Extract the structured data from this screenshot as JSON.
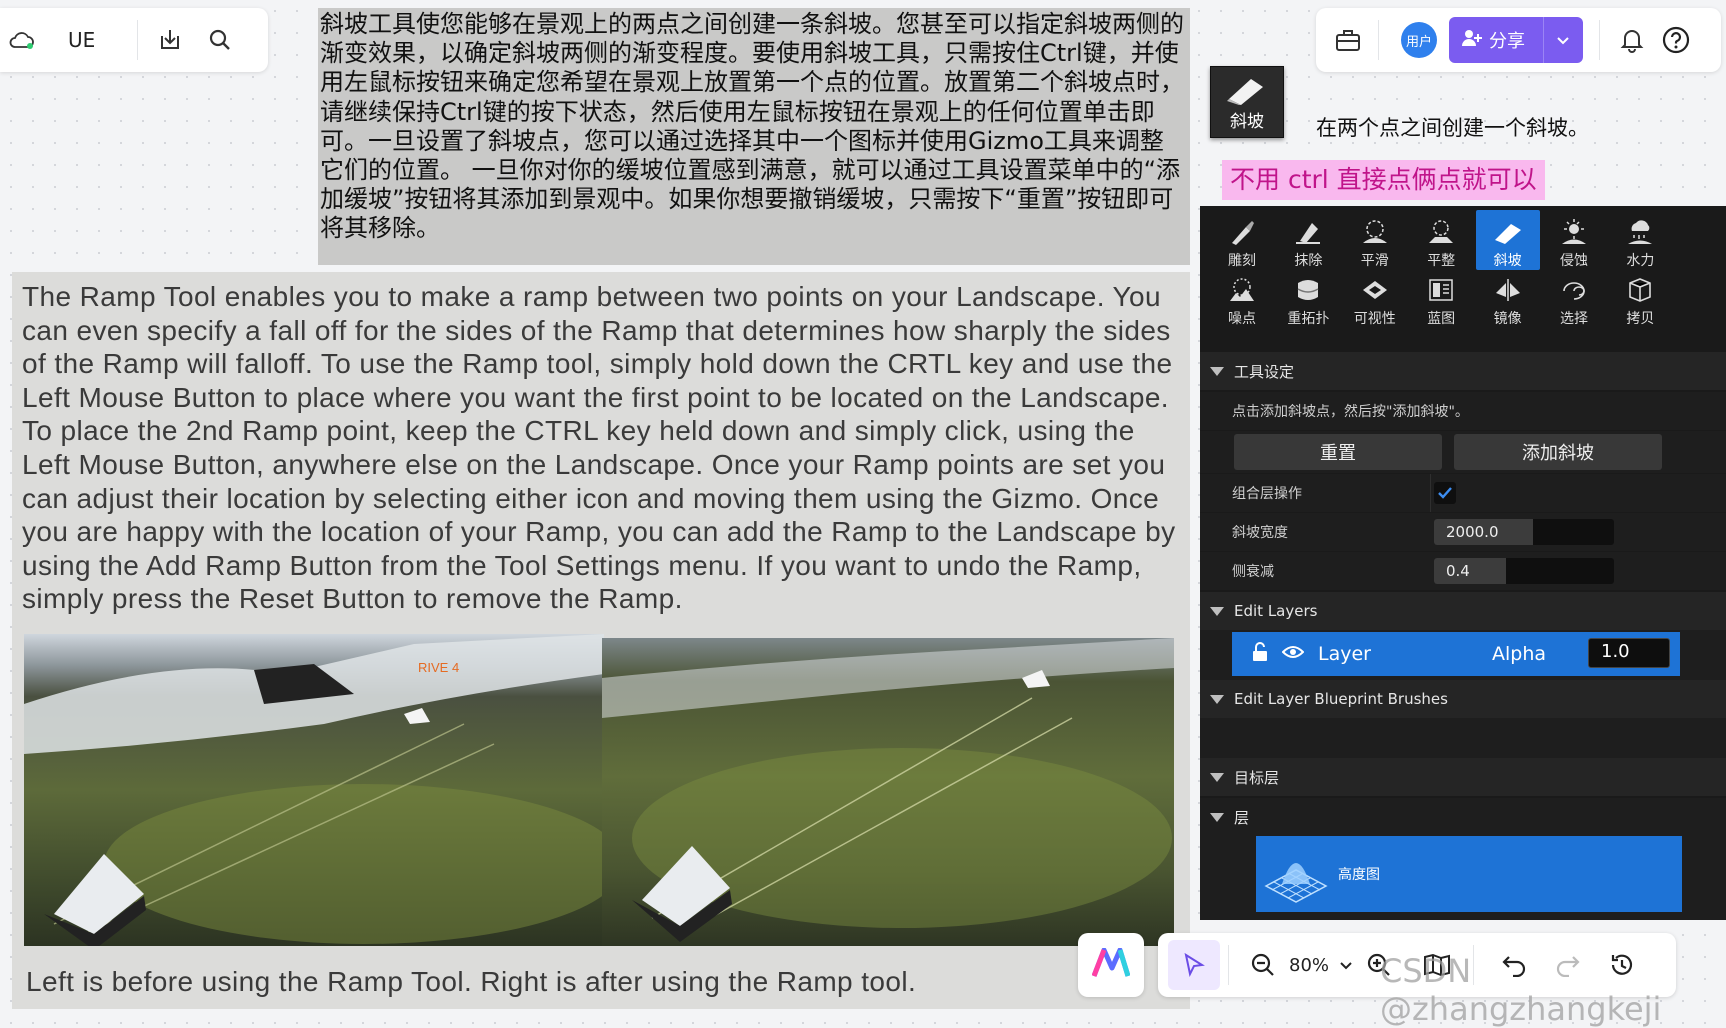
{
  "toolbar_left": {
    "app_label": "UE"
  },
  "toolbar_right": {
    "user_label": "用户",
    "share_label": "分享"
  },
  "cn_paragraph": "斜坡工具使您能够在景观上的两点之间创建一条斜坡。您甚至可以指定斜坡两侧的渐变效果，以确定斜坡两侧的渐变程度。要使用斜坡工具，只需按住Ctrl键，并使用左鼠标按钮来确定您希望在景观上放置第一个点的位置。放置第二个斜坡点时，请继续保持Ctrl键的按下状态，然后使用左鼠标按钮在景观上的任何位置单击即可。一旦设置了斜坡点，您可以通过选择其中一个图标并使用Gizmo工具来调整它们的位置。 一旦你对你的缓坡位置感到满意，就可以通过工具设置菜单中的“添加缓坡”按钮将其添加到景观中。如果你想要撤销缓坡，只需按下“重置”按钮即可将其移除。",
  "en_paragraph": "The Ramp Tool enables you to make a ramp between two points on your Landscape. You can even specify a fall off for the sides of the Ramp that determines how sharply the sides of the Ramp will falloff. To use the Ramp tool, simply hold down the CRTL key and use the Left Mouse Button to place where you want the first point to be located on the Landscape. To place the 2nd Ramp point, keep the CTRL key held down and simply click, using the Left Mouse Button, anywhere else on the Landscape. Once your Ramp points are set you can adjust their location by selecting either icon and moving them using the Gizmo. Once you are happy with the location of your Ramp, you can add the Ramp to the Landscape by using the Add Ramp Button from the Tool Settings menu. If you want to undo the Ramp, simply press the Reset Button to remove the Ramp.",
  "photo_label": "RIVE 4",
  "caption": "Left is before using the Ramp Tool. Right is after using the Ramp tool.",
  "ramp_icon_label": "斜坡",
  "ramp_desc": "在两个点之间创建一个斜坡。",
  "note": "不用 ctrl 直接点俩点就可以",
  "tools": [
    {
      "label": "雕刻",
      "icon": "sculpt-icon"
    },
    {
      "label": "抹除",
      "icon": "erase-icon"
    },
    {
      "label": "平滑",
      "icon": "smooth-icon"
    },
    {
      "label": "平整",
      "icon": "flatten-icon"
    },
    {
      "label": "斜坡",
      "icon": "ramp-icon"
    },
    {
      "label": "侵蚀",
      "icon": "erosion-icon"
    },
    {
      "label": "水力",
      "icon": "hydro-icon"
    },
    {
      "label": "噪点",
      "icon": "noise-icon"
    },
    {
      "label": "重拓扑",
      "icon": "retopologize-icon"
    },
    {
      "label": "可视性",
      "icon": "visibility-icon"
    },
    {
      "label": "蓝图",
      "icon": "blueprint-icon"
    },
    {
      "label": "镜像",
      "icon": "mirror-icon"
    },
    {
      "label": "选择",
      "icon": "select-icon"
    },
    {
      "label": "拷贝",
      "icon": "copy-icon"
    }
  ],
  "tool_settings": {
    "header": "工具设定",
    "hint": "点击添加斜坡点，然后按\"添加斜坡\"。",
    "reset_label": "重置",
    "add_ramp_label": "添加斜坡",
    "layer_op_label": "组合层操作",
    "layer_op_checked": true,
    "ramp_width_label": "斜坡宽度",
    "ramp_width_value": "2000.0",
    "ramp_width_fill": 0.55,
    "side_falloff_label": "侧衰减",
    "side_falloff_value": "0.4",
    "side_falloff_fill": 0.4
  },
  "edit_layers": {
    "header": "Edit Layers",
    "layer_name": "Layer",
    "alpha_label": "Alpha",
    "alpha_value": "1.0"
  },
  "blueprint_brushes": {
    "header": "Edit Layer Blueprint Brushes"
  },
  "target_layer": {
    "header": "目标层",
    "layers_header": "层",
    "heightmap_label": "高度图"
  },
  "bottom_toolbar": {
    "zoom": "80%"
  },
  "watermark": "CSDN @zhangzhangkeji",
  "colors": {
    "accent": "#1e73d6",
    "share": "#7b5cf0",
    "note_bg": "#f9b8ee",
    "note_text": "#c0148a"
  }
}
